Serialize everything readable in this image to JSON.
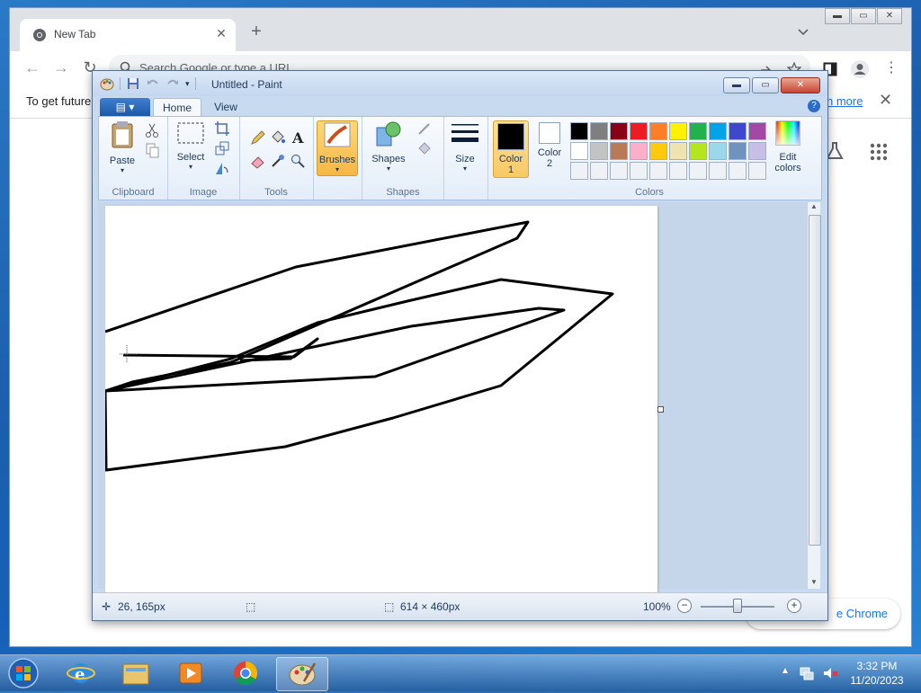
{
  "chrome": {
    "tab_title": "New Tab",
    "omnibox_placeholder": "Search Google or type a URL",
    "infobar_text": "To get future",
    "infobar_link": "n more",
    "customize_label": "e Chrome"
  },
  "paint": {
    "window_title": "Untitled - Paint",
    "tabs": {
      "home": "Home",
      "view": "View"
    },
    "clipboard": {
      "paste": "Paste",
      "label": "Clipboard"
    },
    "image": {
      "select": "Select",
      "label": "Image"
    },
    "tools": {
      "label": "Tools"
    },
    "brushes": {
      "label": "Brushes"
    },
    "shapes": {
      "label": "Shapes",
      "group_label": "Shapes"
    },
    "size": {
      "label": "Size"
    },
    "colors": {
      "color1_label": "Color",
      "color1_num": "1",
      "color2_label": "Color",
      "color2_num": "2",
      "edit_label_1": "Edit",
      "edit_label_2": "colors",
      "group_label": "Colors",
      "color1_value": "#000000",
      "color2_value": "#ffffff",
      "palette": [
        "#000000",
        "#7f7f7f",
        "#880015",
        "#ed1c24",
        "#ff7f27",
        "#fff200",
        "#22b14c",
        "#00a2e8",
        "#3f48cc",
        "#a349a4",
        "#ffffff",
        "#c3c3c3",
        "#b97a57",
        "#ffaec9",
        "#ffc90e",
        "#efe4b0",
        "#b5e61d",
        "#99d9ea",
        "#7092be",
        "#c8bfe7",
        "#eef2f7",
        "#eef2f7",
        "#eef2f7",
        "#eef2f7",
        "#eef2f7",
        "#eef2f7",
        "#eef2f7",
        "#eef2f7",
        "#eef2f7",
        "#eef2f7"
      ]
    },
    "status": {
      "cursor_pos": "26, 165px",
      "canvas_size": "614 × 460px",
      "zoom": "100%"
    }
  },
  "taskbar": {
    "time": "3:32 PM",
    "date": "11/20/2023"
  }
}
